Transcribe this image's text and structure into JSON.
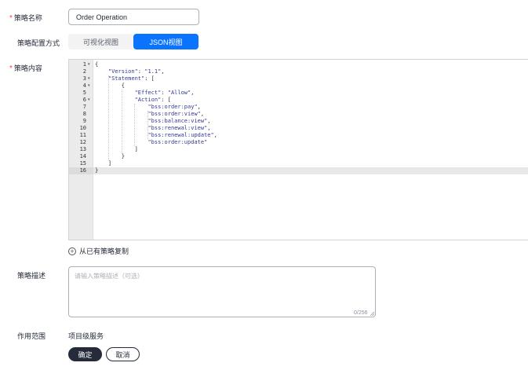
{
  "form": {
    "name_label": "策略名称",
    "name_value": "Order Operation",
    "config_label": "策略配置方式",
    "view_visual": "可视化视图",
    "view_json": "JSON视图",
    "content_label": "策略内容",
    "copy_existing": "从已有策略复制",
    "desc_label": "策略描述",
    "desc_placeholder": "请输入策略描述（可选）",
    "desc_counter": "0/256",
    "scope_label": "作用范围",
    "scope_value": "项目级服务",
    "confirm": "确定",
    "cancel": "取消"
  },
  "editor": {
    "lines": [
      "{",
      "    \"Version\": \"1.1\",",
      "    \"Statement\": [",
      "        {",
      "            \"Effect\": \"Allow\",",
      "            \"Action\": [",
      "                \"bss:order:pay\",",
      "                \"bss:order:view\",",
      "                \"bss:balance:view\",",
      "                \"bss:renewal:view\",",
      "                \"bss:renewal:update\",",
      "                \"bss:order:update\"",
      "            ]",
      "        }",
      "    ]",
      "}"
    ],
    "line_numbers": [
      "1",
      "2",
      "3",
      "4",
      "5",
      "6",
      "7",
      "8",
      "9",
      "10",
      "11",
      "12",
      "13",
      "14",
      "15",
      "16"
    ],
    "foldable_lines": [
      1,
      3,
      4,
      6
    ],
    "active_line": 16
  },
  "colors": {
    "primary": "#0a74ff",
    "required": "#e84b3c",
    "dark_button": "#252b3a"
  }
}
